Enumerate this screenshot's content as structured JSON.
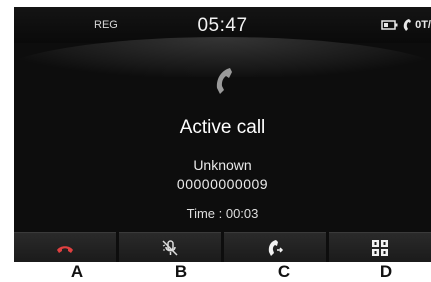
{
  "status_bar": {
    "left_label": "REG",
    "time": "05:47",
    "right_text": "0T/"
  },
  "call": {
    "title": "Active call",
    "caller_name": "Unknown",
    "caller_number": "00000000009",
    "duration_text": "Time : 00:03"
  },
  "buttons": [
    {
      "icon": "end-call-icon"
    },
    {
      "icon": "mute-microphone-icon"
    },
    {
      "icon": "switch-to-handset-icon"
    },
    {
      "icon": "dialpad-icon"
    }
  ],
  "callouts": [
    "A",
    "B",
    "C",
    "D"
  ]
}
